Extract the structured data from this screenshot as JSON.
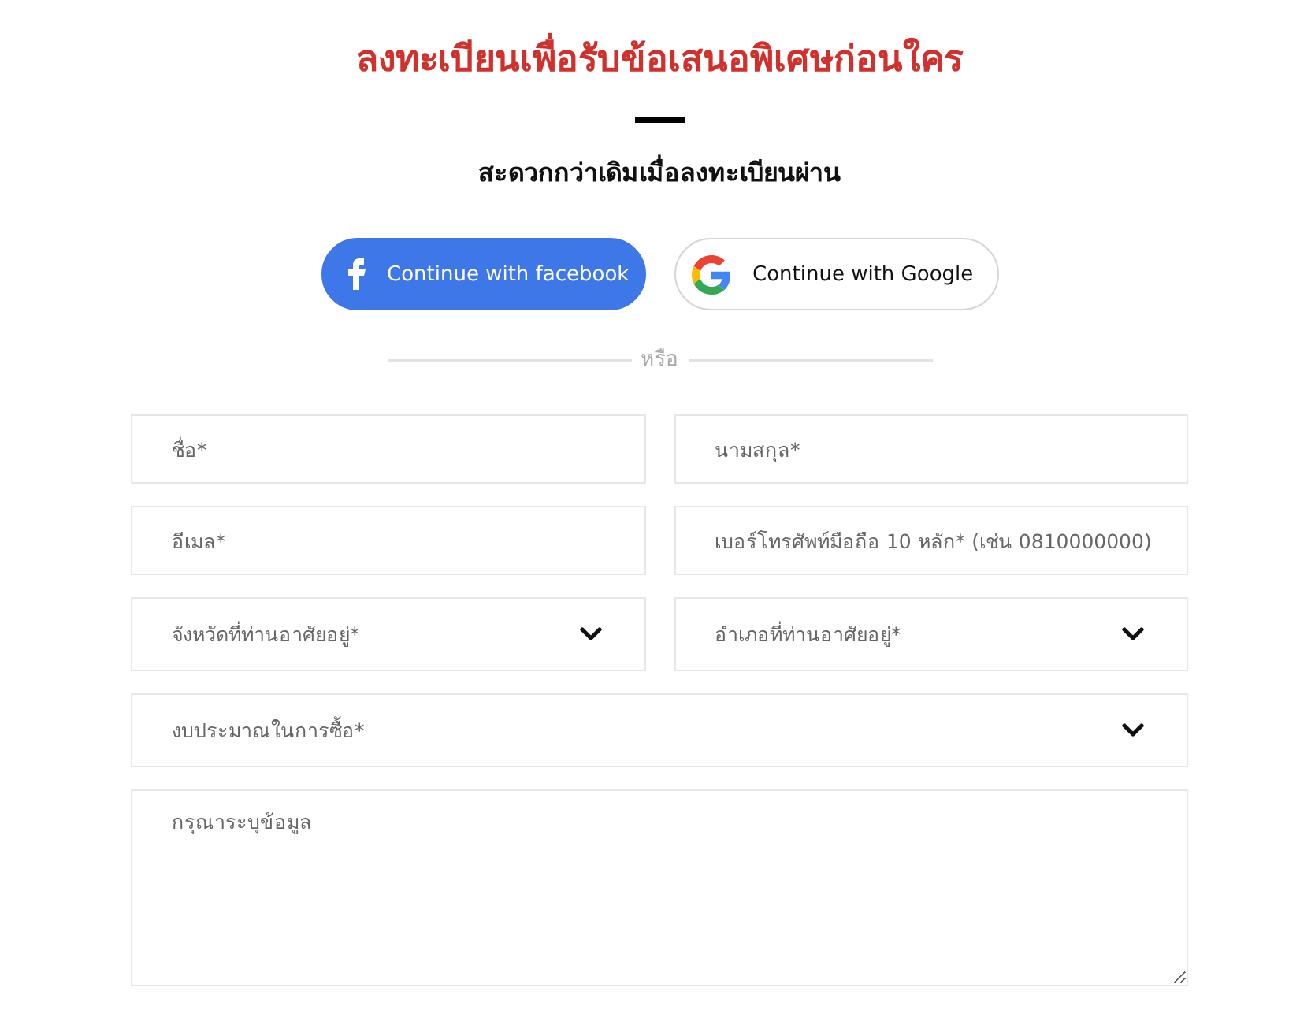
{
  "heading": {
    "title": "ลงทะเบียนเพื่อรับข้อเสนอพิเศษก่อนใคร",
    "subtitle": "สะดวกกว่าเดิมเมื่อลงทะเบียนผ่าน"
  },
  "social_buttons": [
    {
      "kind": "facebook",
      "label": "Continue with facebook"
    },
    {
      "kind": "google",
      "label": "Continue with Google"
    }
  ],
  "divider": {
    "label": "หรือ"
  },
  "form": {
    "rows": [
      {
        "fields": [
          {
            "kind": "input",
            "placeholder": "ชื่อ*"
          },
          {
            "kind": "input",
            "placeholder": "นามสกุล*"
          }
        ]
      },
      {
        "fields": [
          {
            "kind": "input",
            "placeholder": "อีเมล*"
          },
          {
            "kind": "input",
            "placeholder": "เบอร์โทรศัพท์มือถือ 10 หลัก* (เช่น 0810000000)"
          }
        ]
      },
      {
        "fields": [
          {
            "kind": "select",
            "placeholder": "จังหวัดที่ท่านอาศัยอยู่*"
          },
          {
            "kind": "select",
            "placeholder": "อำเภอที่ท่านอาศัยอยู่*"
          }
        ]
      },
      {
        "fields": [
          {
            "kind": "select",
            "placeholder": "งบประมาณในการซื้อ*"
          }
        ]
      },
      {
        "fields": [
          {
            "kind": "textarea",
            "placeholder": "กรุณาระบุข้อมูล"
          }
        ]
      }
    ]
  }
}
